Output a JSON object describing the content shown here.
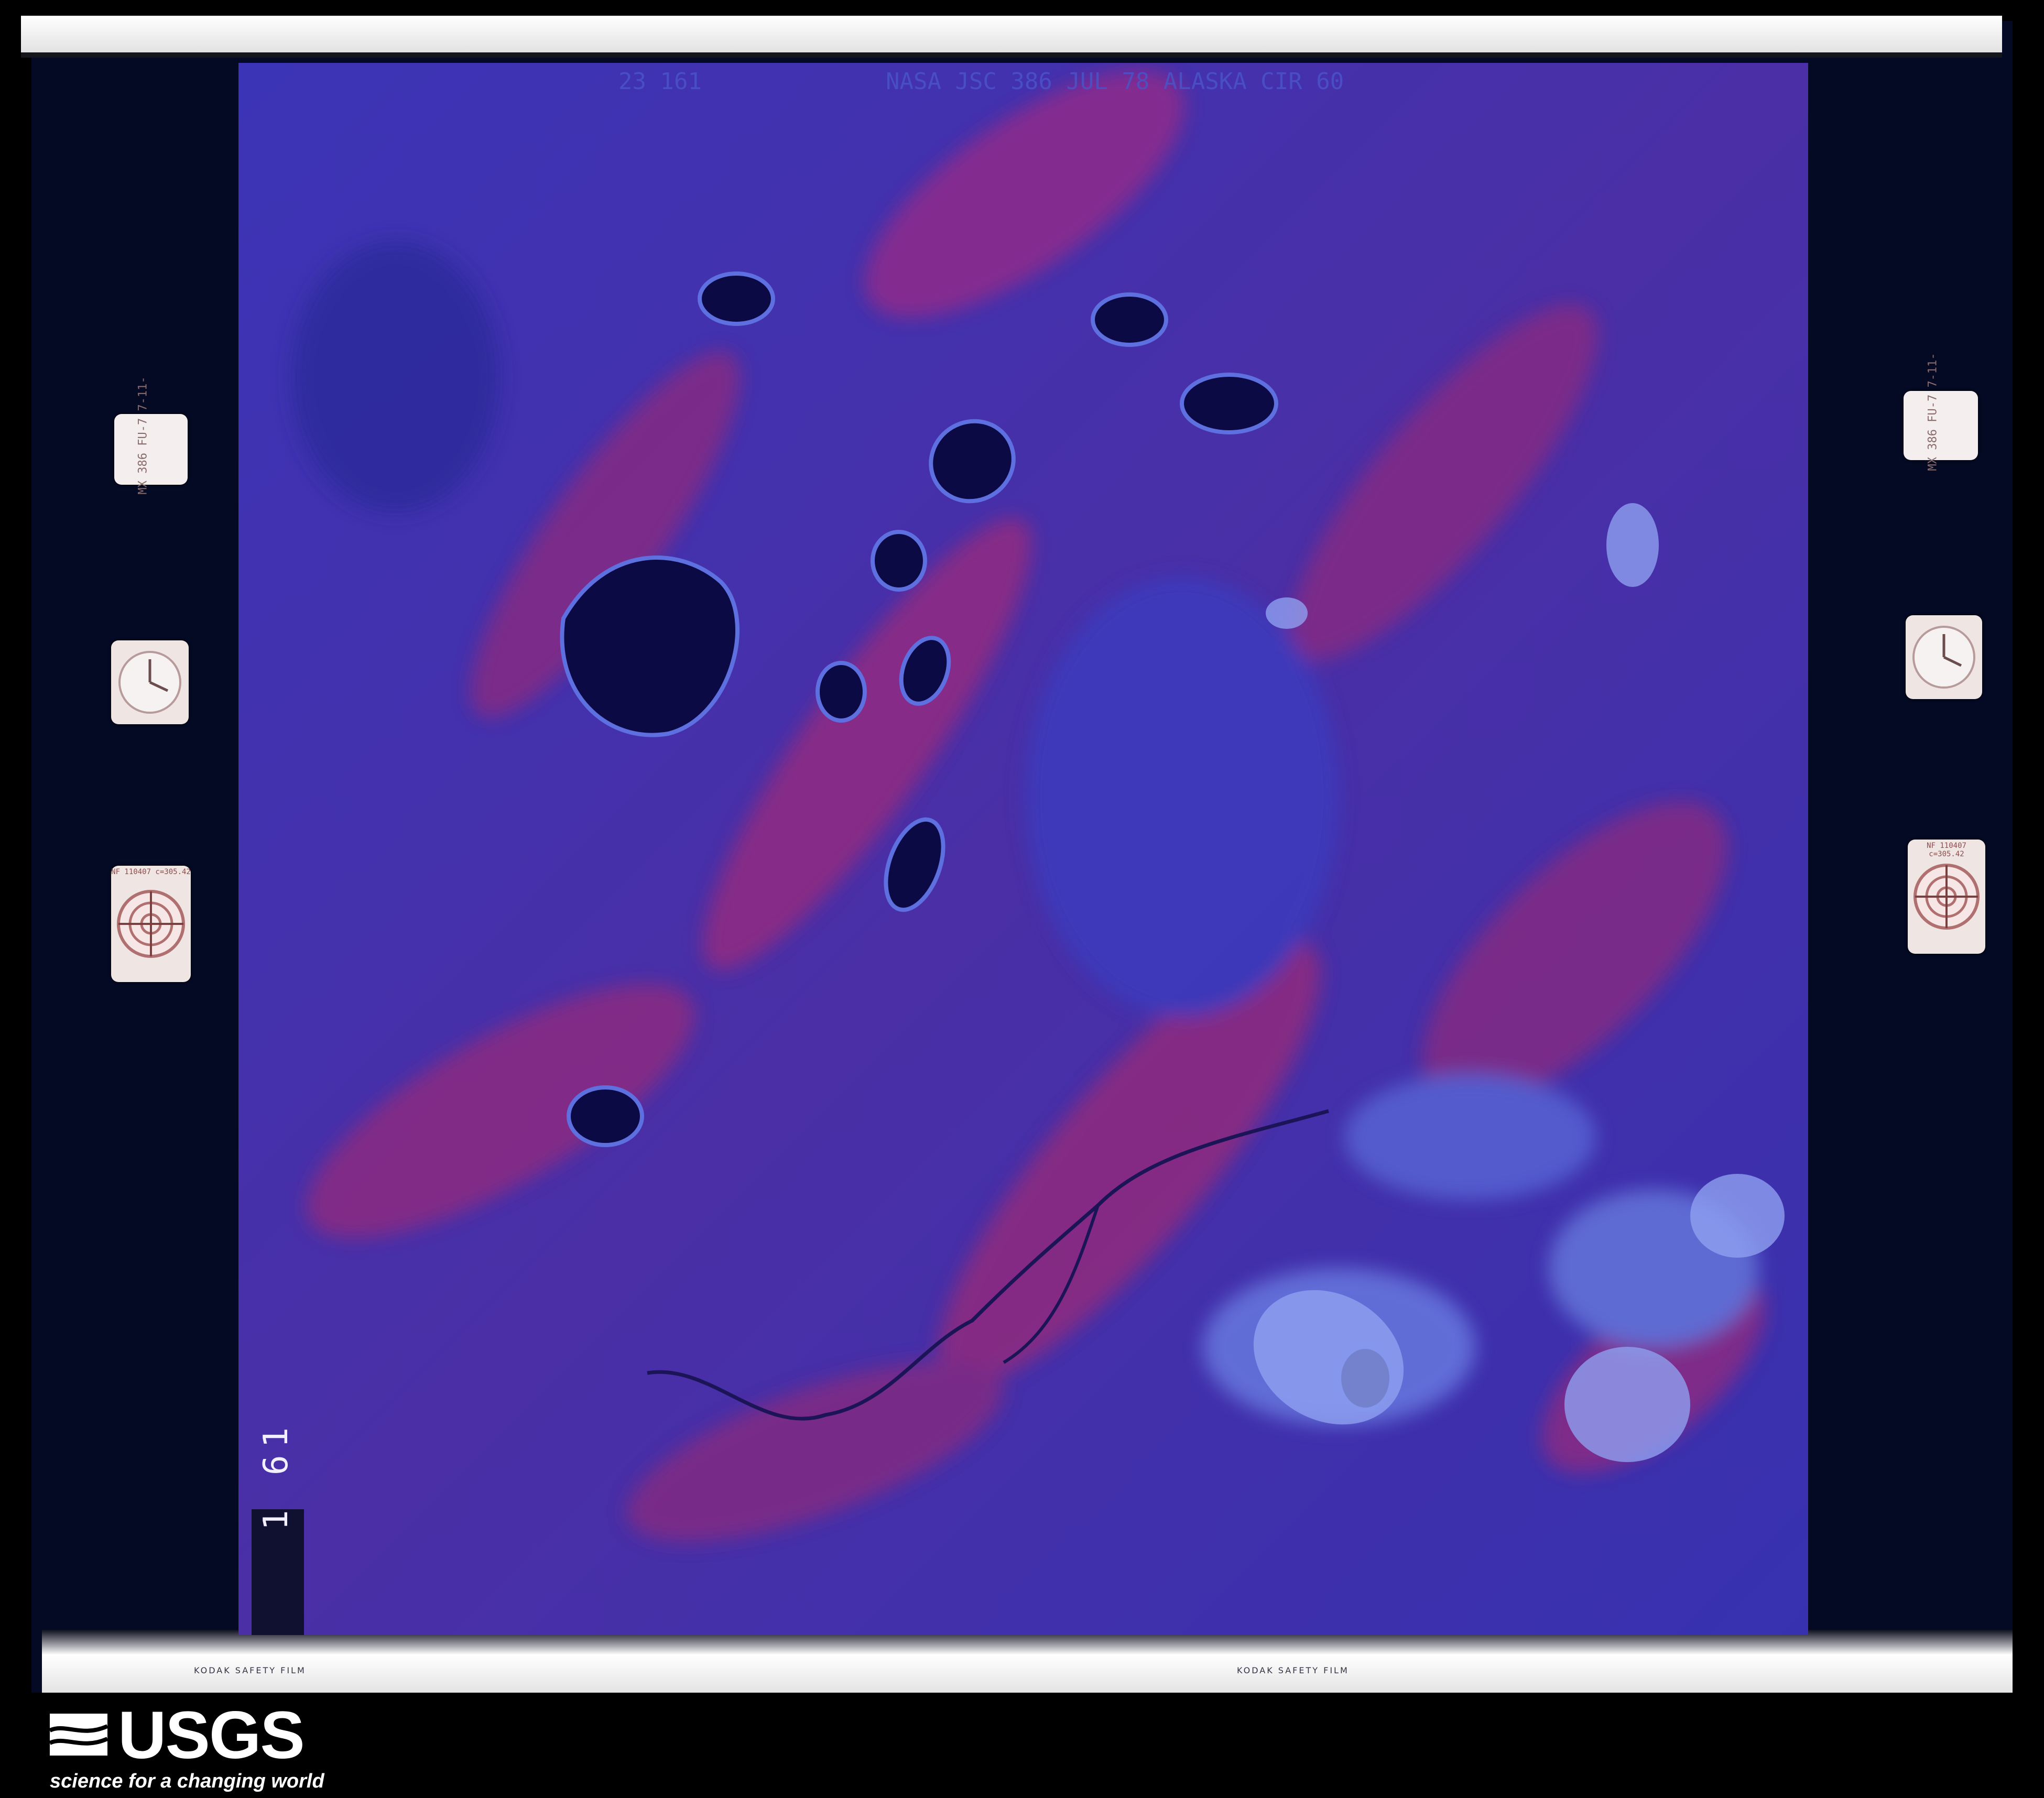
{
  "photo": {
    "header_left": "23 161",
    "header_right": "NASA JSC 386 JUL 78 ALASKA CIR 60",
    "frame_number": "1 61",
    "film_edge_left": "KODAK SAFETY FILM",
    "film_edge_right": "KODAK SAFETY FILM"
  },
  "fiducials": {
    "note_left": "MX 386 FU-7 7-11-",
    "note_right": "MX 386 FU-7 7-11-",
    "lens_left": "NF 110407  c=305.42",
    "lens_right": "NF 110407  c=305.42"
  },
  "footer": {
    "logo_text": "USGS",
    "tagline": "science for a changing world"
  },
  "colors": {
    "terrain_base": "#3a2fb0",
    "terrain_red": "#a02a7a",
    "water": "#0b0a45",
    "wetland": "#6a7ae0"
  }
}
